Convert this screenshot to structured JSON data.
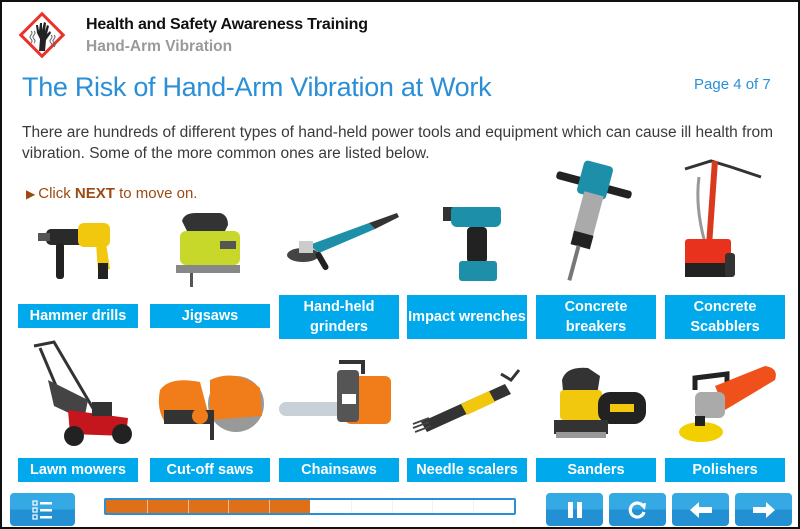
{
  "header": {
    "title": "Health and Safety Awareness Training",
    "subtitle": "Hand-Arm Vibration",
    "logo_icon": "vibration-hazard-icon"
  },
  "page": {
    "title": "The Risk of Hand-Arm Vibration at Work",
    "page_indicator": "Page 4 of 7",
    "intro": "There are hundreds of different types of hand-held power tools and equipment which can cause ill health from vibration. Some of the more common ones are listed below.",
    "instruction": {
      "prefix": "Click ",
      "emphasis": "NEXT",
      "suffix": " to move on."
    }
  },
  "tools": [
    {
      "label": "Hammer drills",
      "icon": "hammer-drill-image"
    },
    {
      "label": "Jigsaws",
      "icon": "jigsaw-image"
    },
    {
      "label": "Hand-held grinders",
      "icon": "angle-grinder-image"
    },
    {
      "label": "Impact wrenches",
      "icon": "impact-wrench-image"
    },
    {
      "label": "Concrete breakers",
      "icon": "concrete-breaker-image"
    },
    {
      "label": "Concrete Scabblers",
      "icon": "concrete-scabbler-image"
    },
    {
      "label": "Lawn mowers",
      "icon": "lawn-mower-image"
    },
    {
      "label": "Cut-off saws",
      "icon": "cut-off-saw-image"
    },
    {
      "label": "Chainsaws",
      "icon": "chainsaw-image"
    },
    {
      "label": "Needle scalers",
      "icon": "needle-scaler-image"
    },
    {
      "label": "Sanders",
      "icon": "sander-image"
    },
    {
      "label": "Polishers",
      "icon": "polisher-image"
    }
  ],
  "footer": {
    "menu_icon": "menu-list-icon",
    "progress": {
      "filled_segments": 5,
      "total_segments": 10,
      "percent": 50
    },
    "controls": [
      {
        "name": "pause-button",
        "icon": "pause-icon"
      },
      {
        "name": "replay-button",
        "icon": "replay-icon"
      },
      {
        "name": "back-button",
        "icon": "arrow-left-icon"
      },
      {
        "name": "next-button",
        "icon": "arrow-right-icon"
      }
    ]
  },
  "colors": {
    "title_blue": "#2a8fd6",
    "label_blue": "#00a8ec",
    "instruction_brown": "#9b4a12",
    "progress_orange": "#e07018",
    "hazard_red": "#e8322a"
  }
}
